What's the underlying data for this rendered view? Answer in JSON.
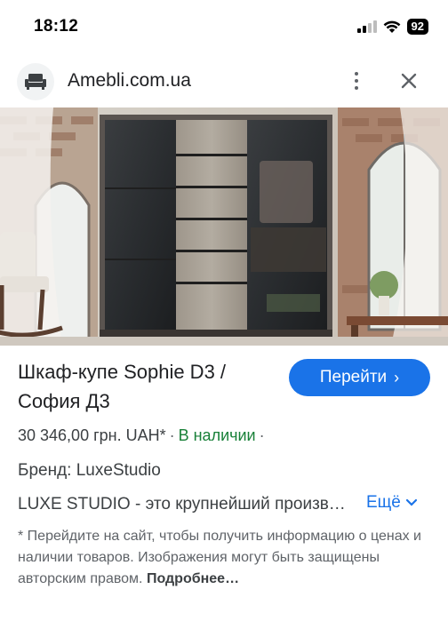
{
  "status_bar": {
    "time": "18:12",
    "battery": "92",
    "icons": [
      "signal-icon",
      "wifi-icon",
      "battery-icon"
    ]
  },
  "header": {
    "site": "Amebli.com.ua",
    "logo_icon": "sofa-icon",
    "menu_icon": "more-vert-icon",
    "close_icon": "close-icon"
  },
  "product": {
    "title": "Шкаф-купе Sophie D3 / София Д3",
    "visit_label": "Перейти",
    "price": "30 346,00 грн. UAH*",
    "availability": "В наличии",
    "separator": "·",
    "brand": "Бренд: LuxeStudio",
    "description": "LUXE STUDIO - это крупнейший производитель мебели",
    "more_label": "Ещё",
    "disclaimer": "* Перейдите на сайт, чтобы получить информацию о ценах и наличии товаров. Изображения могут быть защищены авторским правом.",
    "disclaimer_more": "Подробнее…"
  },
  "colors": {
    "accent": "#1a73e8",
    "in_stock": "#188038",
    "text": "#202124",
    "secondary_text": "#5f6368"
  }
}
